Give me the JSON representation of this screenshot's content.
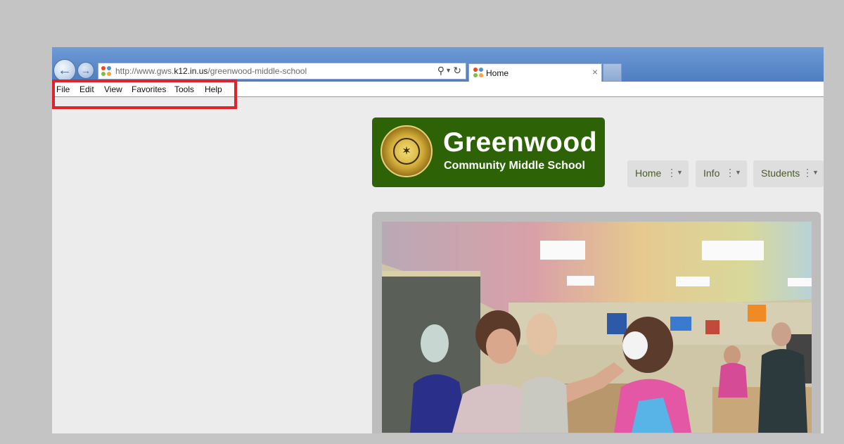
{
  "browser": {
    "url_prefix": "http://www.gws.",
    "url_domain": "k12.in.us",
    "url_path": "/greenwood-middle-school",
    "tab_title": "Home",
    "tab_close": "×"
  },
  "menu": {
    "items": [
      {
        "label": "File"
      },
      {
        "label": "Edit"
      },
      {
        "label": "View"
      },
      {
        "label": "Favorites"
      },
      {
        "label": "Tools"
      },
      {
        "label": "Help"
      }
    ]
  },
  "site": {
    "logo_title": "Greenwood",
    "logo_subtitle": "Community Middle School",
    "nav": [
      {
        "label": "Home"
      },
      {
        "label": "Info"
      },
      {
        "label": "Students"
      }
    ]
  },
  "colors": {
    "highlight": "#e0222c",
    "logo_green": "#2d6207",
    "titlebar_blue": "#5f8ccc"
  }
}
